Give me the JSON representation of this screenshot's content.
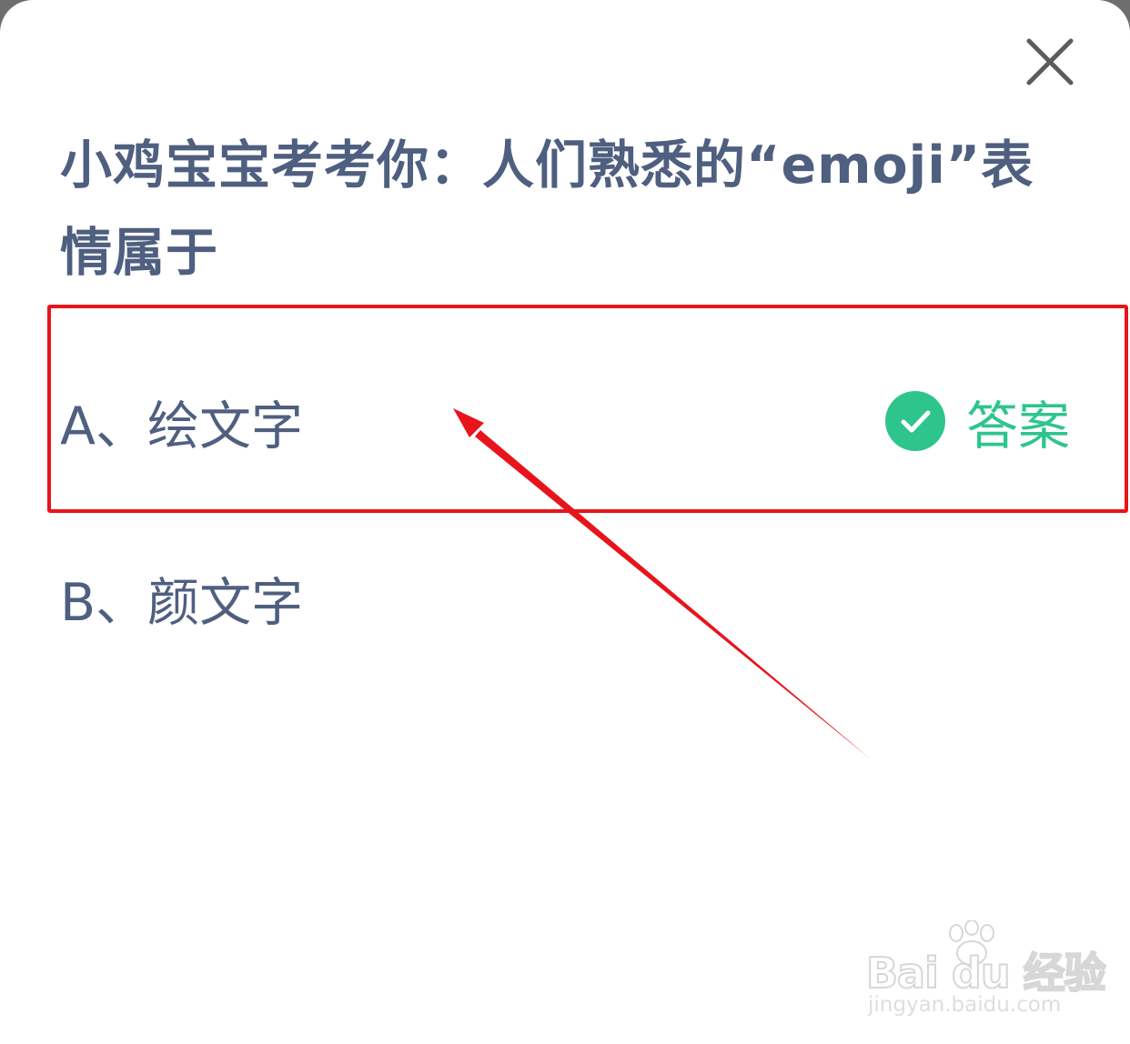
{
  "dialog": {
    "question": "小鸡宝宝考考你：人们熟悉的“emoji”表情属于",
    "options": [
      {
        "text": "A、绘文字",
        "is_answer": true,
        "answer_label": "答案"
      },
      {
        "text": "B、颜文字",
        "is_answer": false
      }
    ]
  },
  "icons": {
    "close": "close-icon",
    "answer": "check-circle-icon"
  },
  "colors": {
    "question_text": "#4f5f80",
    "answer_green": "#2ec58d",
    "annotation_red": "#e8141c"
  },
  "watermark": {
    "logo_text": "Bai du 经验",
    "url": "jingyan.baidu.com"
  }
}
